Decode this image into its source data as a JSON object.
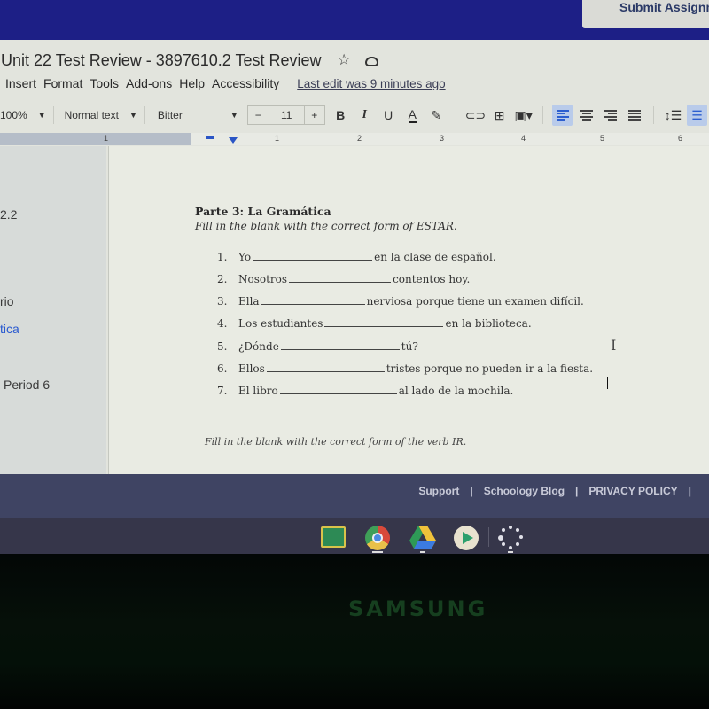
{
  "schoology": {
    "submit_label": "Submit Assignm"
  },
  "docs": {
    "title": "Unit 22 Test Review - 3897610.2 Test Review",
    "menu": [
      "Insert",
      "Format",
      "Tools",
      "Add-ons",
      "Help",
      "Accessibility"
    ],
    "last_edit": "Last edit was 9 minutes ago",
    "toolbar": {
      "zoom": "100%",
      "style": "Normal text",
      "font": "Bitter",
      "font_size": "11",
      "minus": "−",
      "plus": "+",
      "bold": "B",
      "italic": "I",
      "underline": "U",
      "text_color": "A"
    },
    "ruler": {
      "numbers": [
        "1",
        "1",
        "2",
        "3",
        "4",
        "5",
        "6"
      ]
    },
    "outline": [
      {
        "text": "2.2"
      },
      {
        "text": "rio"
      },
      {
        "text": "tica"
      },
      {
        "text": "Period 6"
      }
    ],
    "document": {
      "section_title": "Parte 3: La Gramática",
      "section_instructions": "Fill in the blank with the correct form of ESTAR.",
      "questions": [
        {
          "num": "1.",
          "subject": "Yo",
          "rest": "en la clase de español."
        },
        {
          "num": "2.",
          "subject": "Nosotros",
          "rest": "contentos hoy."
        },
        {
          "num": "3.",
          "subject": "Ella",
          "rest": "nerviosa porque tiene un examen difícil."
        },
        {
          "num": "4.",
          "subject": "Los estudiantes",
          "rest": "en la biblioteca."
        },
        {
          "num": "5.",
          "subject": "¿Dónde",
          "rest": "tú?"
        },
        {
          "num": "6.",
          "subject": "Ellos",
          "rest": "tristes porque no pueden ir a la fiesta."
        },
        {
          "num": "7.",
          "subject": "El libro",
          "rest": "al lado de la mochila."
        }
      ],
      "next_instructions": "Fill in the blank with the correct form of the verb IR."
    }
  },
  "footer": {
    "links": [
      "Support",
      "Schoology Blog",
      "PRIVACY POLICY"
    ],
    "separator": "|"
  },
  "shelf": {
    "apps": [
      "classroom",
      "chrome",
      "drive",
      "play-store",
      "launcher"
    ]
  },
  "bezel": {
    "brand": "SAMSUNG"
  }
}
